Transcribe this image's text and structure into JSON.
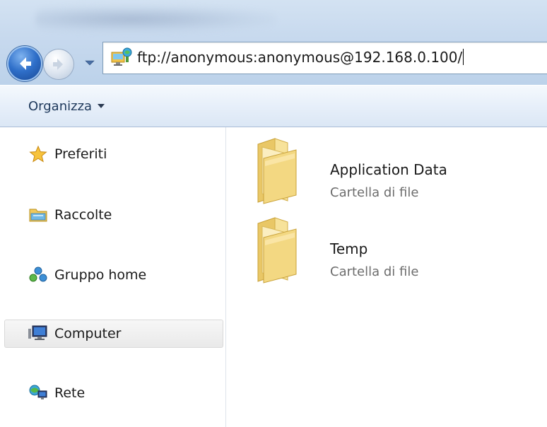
{
  "address": {
    "value": "ftp://anonymous:anonymous@192.168.0.100/"
  },
  "command_bar": {
    "organize_label": "Organizza"
  },
  "nav": {
    "items": [
      {
        "label": "Preferiti",
        "icon": "star-icon"
      },
      {
        "label": "Raccolte",
        "icon": "libraries-icon"
      },
      {
        "label": "Gruppo home",
        "icon": "homegroup-icon"
      },
      {
        "label": "Computer",
        "icon": "computer-icon",
        "selected": true
      },
      {
        "label": "Rete",
        "icon": "network-icon"
      }
    ]
  },
  "files": [
    {
      "name": "Application Data",
      "type": "Cartella di file",
      "icon": "folder-icon"
    },
    {
      "name": "Temp",
      "type": "Cartella di file",
      "icon": "folder-icon"
    }
  ],
  "colors": {
    "title_gradient_top": "#d3e2f2",
    "command_bar": "#e8f0fa",
    "selection": "#e9e9e9",
    "secondary_text": "#6d6d6d"
  }
}
